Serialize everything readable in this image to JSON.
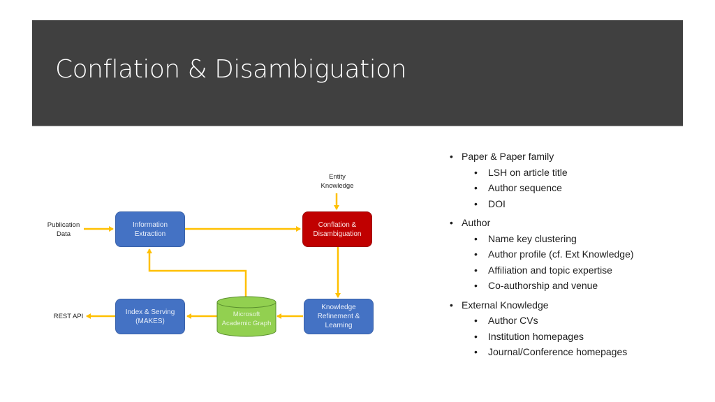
{
  "slide": {
    "title": "Conflation & Disambiguation",
    "colors": {
      "title_bar": "#404040",
      "arrow": "#ffc000",
      "blue_node": "#4472c4",
      "red_node": "#c00000",
      "green_db": "#92d050"
    }
  },
  "diagram": {
    "inputs": {
      "publication_data": "Publication\nData",
      "entity_knowledge": "Entity\nKnowledge",
      "rest_api": "REST API"
    },
    "nodes": {
      "information_extraction": "Information\nExtraction",
      "conflation": "Conflation &\nDisambiguation",
      "knowledge_refinement": "Knowledge\nRefinement &\nLearning",
      "academic_graph": "Microsoft\nAcademic Graph",
      "index_serving": "Index & Serving\n(MAKES)"
    }
  },
  "bullets": [
    {
      "label": "Paper & Paper family",
      "children": [
        "LSH on article title",
        "Author sequence",
        "DOI"
      ]
    },
    {
      "label": "Author",
      "children": [
        "Name key clustering",
        "Author profile (cf. Ext Knowledge)",
        "Affiliation and topic expertise",
        "Co-authorship and venue"
      ]
    },
    {
      "label": "External Knowledge",
      "children": [
        "Author CVs",
        "Institution homepages",
        "Journal/Conference homepages"
      ]
    }
  ]
}
